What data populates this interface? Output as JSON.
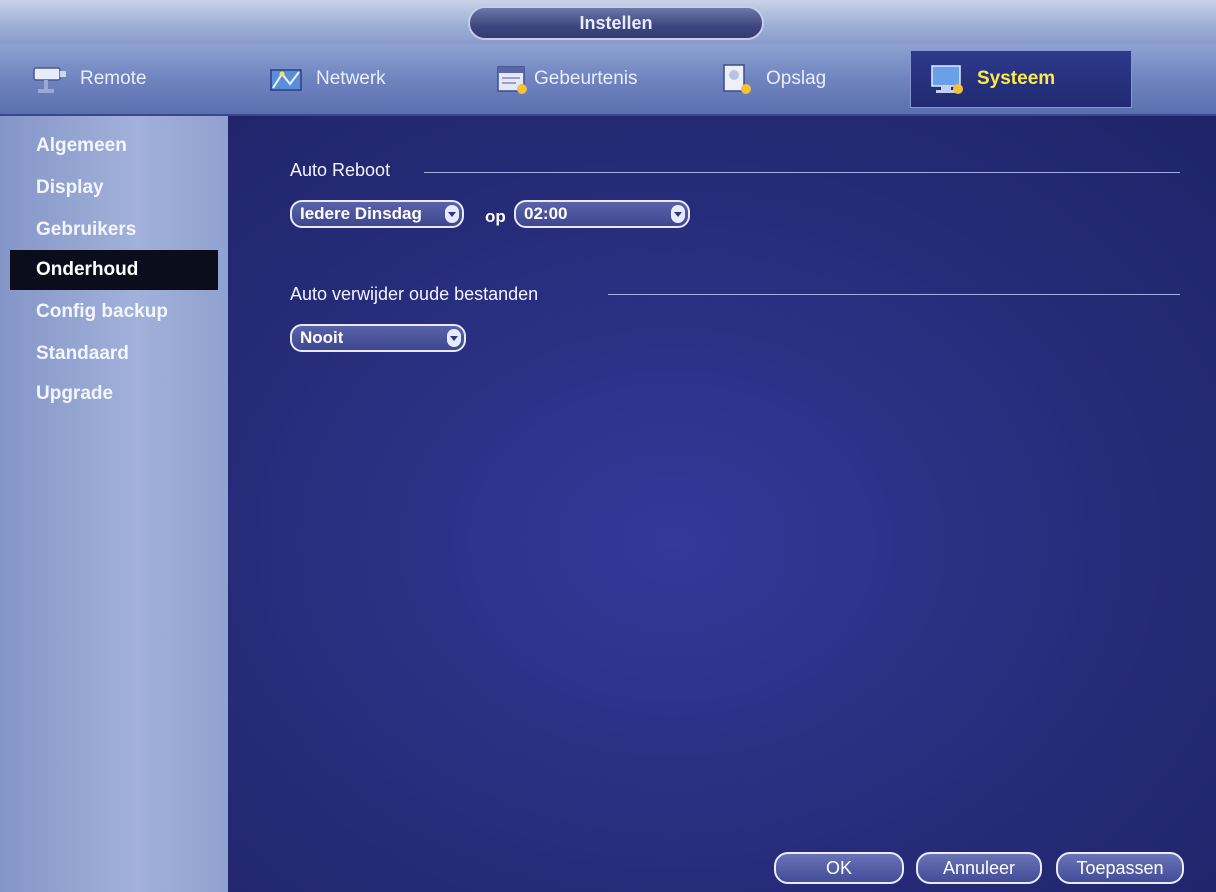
{
  "window": {
    "title": "Instellen"
  },
  "tabs": [
    {
      "label": "Remote",
      "icon": "camera-icon"
    },
    {
      "label": "Netwerk",
      "icon": "network-icon"
    },
    {
      "label": "Gebeurtenis",
      "icon": "event-icon"
    },
    {
      "label": "Opslag",
      "icon": "storage-icon"
    },
    {
      "label": "Systeem",
      "icon": "system-icon",
      "active": true
    }
  ],
  "sidebar": {
    "items": [
      {
        "label": "Algemeen"
      },
      {
        "label": "Display"
      },
      {
        "label": "Gebruikers"
      },
      {
        "label": "Onderhoud",
        "active": true
      },
      {
        "label": "Config backup"
      },
      {
        "label": "Standaard"
      },
      {
        "label": "Upgrade"
      }
    ]
  },
  "auto_reboot": {
    "label": "Auto Reboot",
    "day_value": "Iedere Dinsdag",
    "connector": "op",
    "time_value": "02:00"
  },
  "auto_delete": {
    "label": "Auto verwijder oude bestanden",
    "value": "Nooit"
  },
  "buttons": {
    "ok": "OK",
    "cancel": "Annuleer",
    "apply": "Toepassen"
  },
  "colors": {
    "active_tab_text": "#ffe94a",
    "panel": "#2a2f7e",
    "sidebar_selected": "#0b0d1c"
  }
}
